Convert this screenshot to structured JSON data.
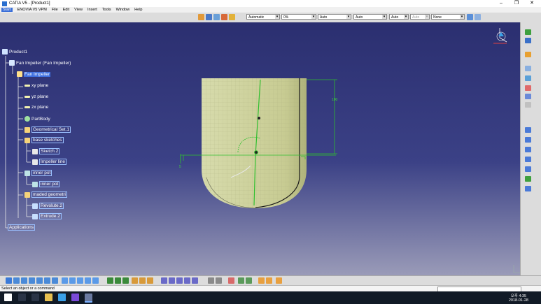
{
  "window": {
    "title": "CATIA V5 - [Product1]",
    "minimize": "–",
    "restore": "❐",
    "close": "✕"
  },
  "menu": [
    "Start",
    "ENOVIA V5 VPM",
    "File",
    "Edit",
    "View",
    "Insert",
    "Tools",
    "Window",
    "Help"
  ],
  "toolbar": {
    "combos": [
      {
        "name": "layer-combo",
        "value": "Automatic"
      },
      {
        "name": "transparency-combo",
        "value": "0%"
      },
      {
        "name": "line-thickness-combo",
        "value": "Auto"
      },
      {
        "name": "line-type-combo",
        "value": "Auto"
      },
      {
        "name": "point-type-combo",
        "value": "Auto"
      },
      {
        "name": "rendering-combo",
        "value": "Auto"
      },
      {
        "name": "layer-filter-combo",
        "value": "None"
      }
    ],
    "dropdown_arrow": "▾"
  },
  "tree": [
    {
      "label": "Product1",
      "icon": "product-icon",
      "color": "#cfe3ff"
    },
    {
      "label": "Fan Impeller (Fan Impeller)",
      "icon": "part-instance-icon",
      "color": "#d7e8ff"
    },
    {
      "label": "Fan Impeller",
      "icon": "part-icon",
      "color": "#ffe08a",
      "selected": true
    },
    {
      "label": "xy plane",
      "icon": "plane-icon",
      "color": "#f2f2b0"
    },
    {
      "label": "yz plane",
      "icon": "plane-icon",
      "color": "#f2f2b0"
    },
    {
      "label": "zx plane",
      "icon": "plane-icon",
      "color": "#f2f2b0"
    },
    {
      "label": "PartBody",
      "icon": "body-gear-icon",
      "color": "#9fe0a0"
    },
    {
      "label": "Geometrical Set.1",
      "icon": "geometrical-set-icon",
      "color": "#f5d27a"
    },
    {
      "label": "base sketches",
      "icon": "geometrical-set-icon",
      "color": "#f5d27a"
    },
    {
      "label": "Sketch.2",
      "icon": "sketch-icon",
      "color": "#e8e8e8"
    },
    {
      "label": "Impeller line",
      "icon": "sketch-icon",
      "color": "#e8e8e8"
    },
    {
      "label": "inner pot",
      "icon": "geometrical-set-icon",
      "color": "#bde3e6"
    },
    {
      "label": "inner pot",
      "icon": "surface-icon",
      "color": "#bde3e6"
    },
    {
      "label": "maded geometri",
      "icon": "geometrical-set-icon",
      "color": "#f5d27a"
    },
    {
      "label": "Revolute.2",
      "icon": "revolute-icon",
      "color": "#c7dfff"
    },
    {
      "label": "Extrude.2",
      "icon": "extrude-icon",
      "color": "#c7dfff"
    },
    {
      "label": "Applications",
      "icon": "",
      "color": "#ffffff"
    }
  ],
  "model": {
    "dim_vertical": "100",
    "dim_small": "5",
    "fill": "#d3d6a3",
    "dark_edge": "#1b1b1b",
    "green": "#2fbf2f"
  },
  "status": {
    "message": "Select an object or a command"
  },
  "taskbar": {
    "time": "오후 4:35",
    "date": "2018-01-28"
  }
}
